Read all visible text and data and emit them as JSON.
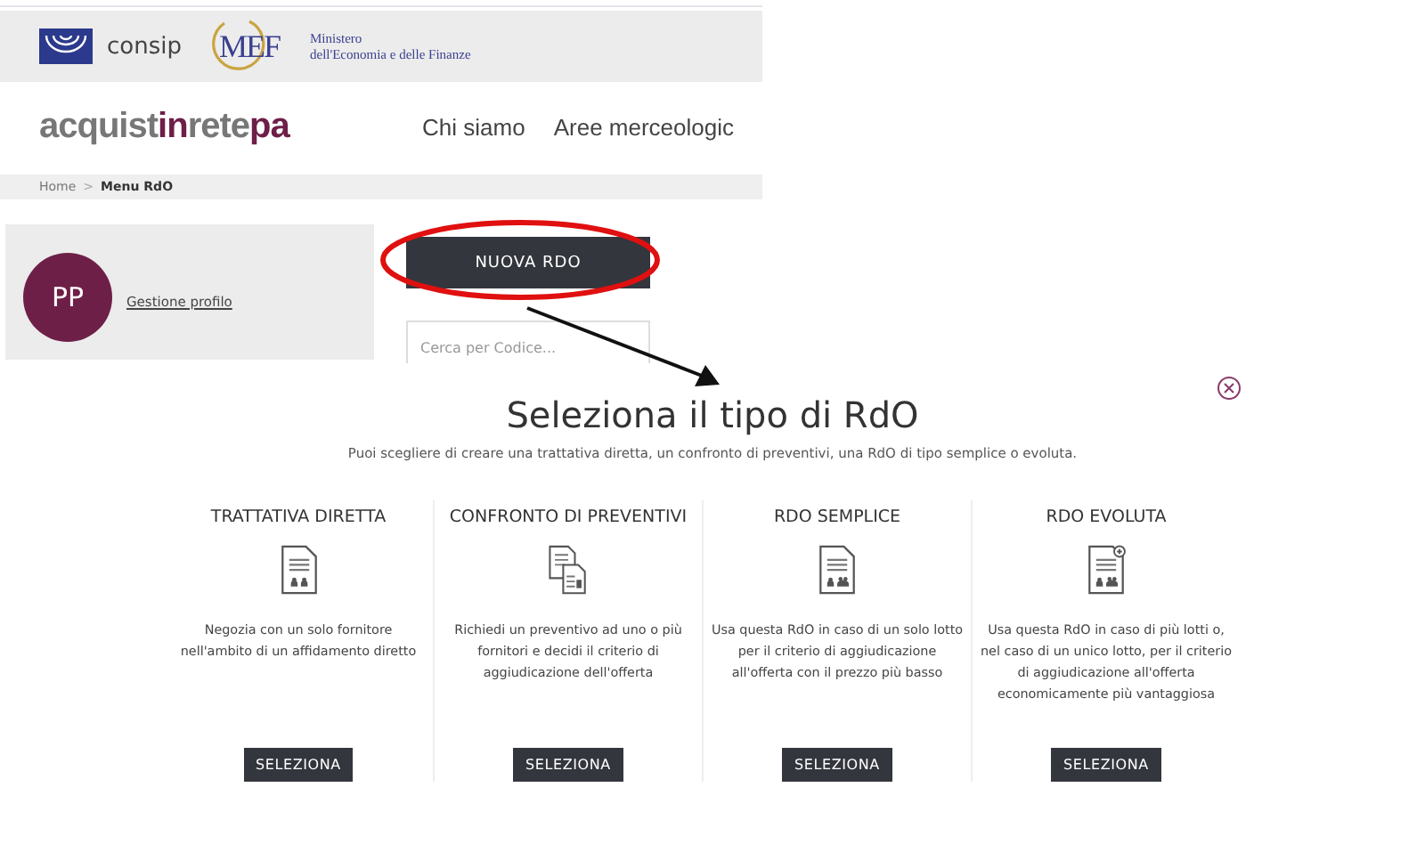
{
  "header": {
    "consip": "consip",
    "mef": "MEF",
    "ministry_lines": [
      "Ministero",
      "dell'Economia e delle Finanze"
    ]
  },
  "logo": [
    "acquist",
    "in",
    "rete",
    "pa"
  ],
  "nav": [
    "Chi siamo",
    "Aree merceologic"
  ],
  "breadcrumb": [
    "Home",
    "Menu RdO"
  ],
  "breadcrumb_separator": ">",
  "profile": {
    "initials": "PP",
    "link": "Gestione profilo"
  },
  "new_button": "NUOVA RDO",
  "search": {
    "placeholder": "Cerca per Codice..."
  },
  "modal": {
    "title": "Seleziona il tipo di RdO",
    "subtitle": "Puoi scegliere di creare una trattativa diretta, un confronto di preventivi, una RdO di tipo semplice o evoluta.",
    "options": [
      {
        "kind": "direct",
        "title": "TRATTATIVA DIRETTA",
        "description": "Negozia con un solo fornitore nell'ambito di un affidamento diretto",
        "button": "SELEZIONA"
      },
      {
        "kind": "compare",
        "title": "CONFRONTO DI PREVENTIVI",
        "description": "Richiedi un preventivo ad uno o più fornitori e decidi il criterio di aggiudicazione dell'offerta",
        "button": "SELEZIONA"
      },
      {
        "kind": "simple",
        "title": "RDO SEMPLICE",
        "description": "Usa questa RdO in caso di un solo lotto per il criterio di aggiudicazione all'offerta con il prezzo più basso",
        "button": "SELEZIONA"
      },
      {
        "kind": "evolved",
        "title": "RDO EVOLUTA",
        "description": "Usa questa RdO in caso di più lotti o, nel caso di un unico lotto, per il criterio di aggiudicazione all'offerta economicamente più vantaggiosa",
        "button": "SELEZIONA"
      }
    ]
  }
}
